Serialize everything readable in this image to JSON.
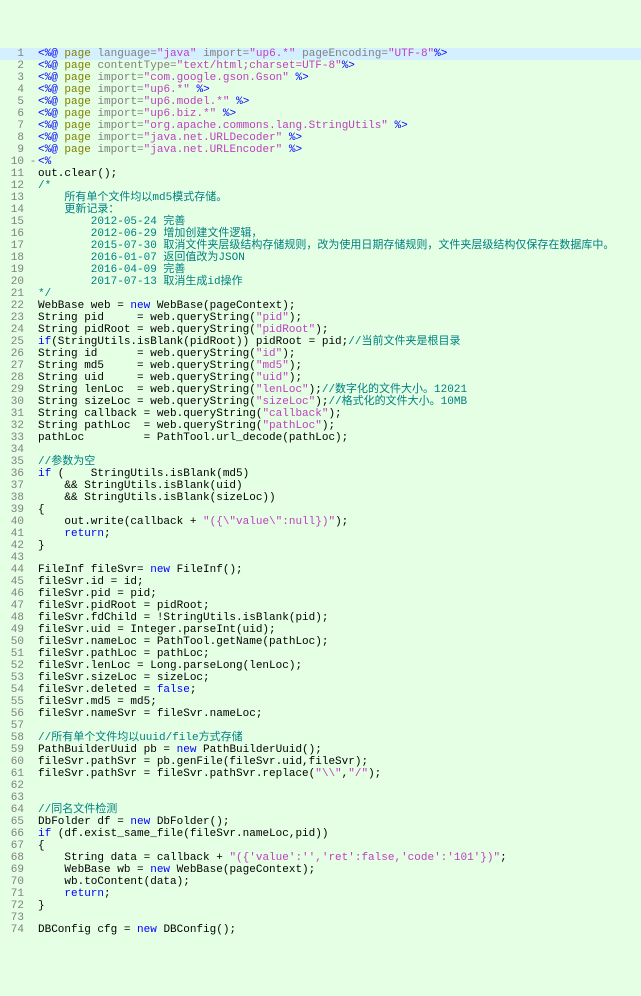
{
  "lines": [
    {
      "n": 1,
      "hl": true,
      "seg": [
        [
          "tag",
          "<%@"
        ],
        [
          "txt",
          " "
        ],
        [
          "dir",
          "page"
        ],
        [
          "txt",
          " "
        ],
        [
          "attr",
          "language="
        ],
        [
          "str",
          "\"java\""
        ],
        [
          "txt",
          " "
        ],
        [
          "attr",
          "import="
        ],
        [
          "str",
          "\"up6.*\""
        ],
        [
          "txt",
          " "
        ],
        [
          "attr",
          "pageEncoding="
        ],
        [
          "str",
          "\"UTF-8\""
        ],
        [
          "tag",
          "%>"
        ]
      ]
    },
    {
      "n": 2,
      "seg": [
        [
          "tag",
          "<%@"
        ],
        [
          "txt",
          " "
        ],
        [
          "dir",
          "page"
        ],
        [
          "txt",
          " "
        ],
        [
          "attr",
          "contentType="
        ],
        [
          "str",
          "\"text/html;charset=UTF-8\""
        ],
        [
          "tag",
          "%>"
        ]
      ]
    },
    {
      "n": 3,
      "seg": [
        [
          "tag",
          "<%@"
        ],
        [
          "txt",
          " "
        ],
        [
          "dir",
          "page"
        ],
        [
          "txt",
          " "
        ],
        [
          "attr",
          "import="
        ],
        [
          "str",
          "\"com.google.gson.Gson\""
        ],
        [
          "txt",
          " "
        ],
        [
          "tag",
          "%>"
        ]
      ]
    },
    {
      "n": 4,
      "seg": [
        [
          "tag",
          "<%@"
        ],
        [
          "txt",
          " "
        ],
        [
          "dir",
          "page"
        ],
        [
          "txt",
          " "
        ],
        [
          "attr",
          "import="
        ],
        [
          "str",
          "\"up6.*\""
        ],
        [
          "txt",
          " "
        ],
        [
          "tag",
          "%>"
        ]
      ]
    },
    {
      "n": 5,
      "seg": [
        [
          "tag",
          "<%@"
        ],
        [
          "txt",
          " "
        ],
        [
          "dir",
          "page"
        ],
        [
          "txt",
          " "
        ],
        [
          "attr",
          "import="
        ],
        [
          "str",
          "\"up6.model.*\""
        ],
        [
          "txt",
          " "
        ],
        [
          "tag",
          "%>"
        ]
      ]
    },
    {
      "n": 6,
      "seg": [
        [
          "tag",
          "<%@"
        ],
        [
          "txt",
          " "
        ],
        [
          "dir",
          "page"
        ],
        [
          "txt",
          " "
        ],
        [
          "attr",
          "import="
        ],
        [
          "str",
          "\"up6.biz.*\""
        ],
        [
          "txt",
          " "
        ],
        [
          "tag",
          "%>"
        ]
      ]
    },
    {
      "n": 7,
      "seg": [
        [
          "tag",
          "<%@"
        ],
        [
          "txt",
          " "
        ],
        [
          "dir",
          "page"
        ],
        [
          "txt",
          " "
        ],
        [
          "attr",
          "import="
        ],
        [
          "str",
          "\"org.apache.commons.lang.StringUtils\""
        ],
        [
          "txt",
          " "
        ],
        [
          "tag",
          "%>"
        ]
      ]
    },
    {
      "n": 8,
      "seg": [
        [
          "tag",
          "<%@"
        ],
        [
          "txt",
          " "
        ],
        [
          "dir",
          "page"
        ],
        [
          "txt",
          " "
        ],
        [
          "attr",
          "import="
        ],
        [
          "str",
          "\"java.net.URLDecoder\""
        ],
        [
          "txt",
          " "
        ],
        [
          "tag",
          "%>"
        ]
      ]
    },
    {
      "n": 9,
      "seg": [
        [
          "tag",
          "<%@"
        ],
        [
          "txt",
          " "
        ],
        [
          "dir",
          "page"
        ],
        [
          "txt",
          " "
        ],
        [
          "attr",
          "import="
        ],
        [
          "str",
          "\"java.net.URLEncoder\""
        ],
        [
          "txt",
          " "
        ],
        [
          "tag",
          "%>"
        ]
      ]
    },
    {
      "n": 10,
      "fold": "-",
      "seg": [
        [
          "tag",
          "<%"
        ]
      ]
    },
    {
      "n": 11,
      "seg": [
        [
          "txt",
          "out.clear();"
        ]
      ]
    },
    {
      "n": 12,
      "seg": [
        [
          "cm",
          "/*"
        ]
      ]
    },
    {
      "n": 13,
      "seg": [
        [
          "cm",
          "    所有单个文件均以md5模式存储。"
        ]
      ]
    },
    {
      "n": 14,
      "seg": [
        [
          "cm",
          "    更新记录："
        ]
      ]
    },
    {
      "n": 15,
      "seg": [
        [
          "cm",
          "        2012-05-24 完善"
        ]
      ]
    },
    {
      "n": 16,
      "seg": [
        [
          "cm",
          "        2012-06-29 增加创建文件逻辑，"
        ]
      ]
    },
    {
      "n": 17,
      "seg": [
        [
          "cm",
          "        2015-07-30 取消文件夹层级结构存储规则，改为使用日期存储规则，文件夹层级结构仅保存在数据库中。"
        ]
      ]
    },
    {
      "n": 18,
      "seg": [
        [
          "cm",
          "        2016-01-07 返回值改为JSON"
        ]
      ]
    },
    {
      "n": 19,
      "seg": [
        [
          "cm",
          "        2016-04-09 完善"
        ]
      ]
    },
    {
      "n": 20,
      "seg": [
        [
          "cm",
          "        2017-07-13 取消生成id操作"
        ]
      ]
    },
    {
      "n": 21,
      "seg": [
        [
          "cm",
          "*/"
        ]
      ]
    },
    {
      "n": 22,
      "seg": [
        [
          "txt",
          "WebBase web = "
        ],
        [
          "kw",
          "new"
        ],
        [
          "txt",
          " WebBase(pageContext);"
        ]
      ]
    },
    {
      "n": 23,
      "seg": [
        [
          "txt",
          "String pid     = web.queryString("
        ],
        [
          "str",
          "\"pid\""
        ],
        [
          "txt",
          ");"
        ]
      ]
    },
    {
      "n": 24,
      "seg": [
        [
          "txt",
          "String pidRoot = web.queryString("
        ],
        [
          "str",
          "\"pidRoot\""
        ],
        [
          "txt",
          ");"
        ]
      ]
    },
    {
      "n": 25,
      "seg": [
        [
          "kw",
          "if"
        ],
        [
          "txt",
          "(StringUtils.isBlank(pidRoot)) pidRoot = pid;"
        ],
        [
          "cm",
          "//当前文件夹是根目录"
        ]
      ]
    },
    {
      "n": 26,
      "seg": [
        [
          "txt",
          "String id      = web.queryString("
        ],
        [
          "str",
          "\"id\""
        ],
        [
          "txt",
          ");"
        ]
      ]
    },
    {
      "n": 27,
      "seg": [
        [
          "txt",
          "String md5     = web.queryString("
        ],
        [
          "str",
          "\"md5\""
        ],
        [
          "txt",
          ");"
        ]
      ]
    },
    {
      "n": 28,
      "seg": [
        [
          "txt",
          "String uid     = web.queryString("
        ],
        [
          "str",
          "\"uid\""
        ],
        [
          "txt",
          ");"
        ]
      ]
    },
    {
      "n": 29,
      "seg": [
        [
          "txt",
          "String lenLoc  = web.queryString("
        ],
        [
          "str",
          "\"lenLoc\""
        ],
        [
          "txt",
          ");"
        ],
        [
          "cm",
          "//数字化的文件大小。12021"
        ]
      ]
    },
    {
      "n": 30,
      "seg": [
        [
          "txt",
          "String sizeLoc = web.queryString("
        ],
        [
          "str",
          "\"sizeLoc\""
        ],
        [
          "txt",
          ");"
        ],
        [
          "cm",
          "//格式化的文件大小。10MB"
        ]
      ]
    },
    {
      "n": 31,
      "seg": [
        [
          "txt",
          "String callback = web.queryString("
        ],
        [
          "str",
          "\"callback\""
        ],
        [
          "txt",
          ");"
        ]
      ]
    },
    {
      "n": 32,
      "seg": [
        [
          "txt",
          "String pathLoc  = web.queryString("
        ],
        [
          "str",
          "\"pathLoc\""
        ],
        [
          "txt",
          ");"
        ]
      ]
    },
    {
      "n": 33,
      "seg": [
        [
          "txt",
          "pathLoc         = PathTool.url_decode(pathLoc);"
        ]
      ]
    },
    {
      "n": 34,
      "seg": [
        [
          "txt",
          ""
        ]
      ]
    },
    {
      "n": 35,
      "seg": [
        [
          "cm",
          "//参数为空"
        ]
      ]
    },
    {
      "n": 36,
      "seg": [
        [
          "kw",
          "if"
        ],
        [
          "txt",
          " (    StringUtils.isBlank(md5)"
        ]
      ]
    },
    {
      "n": 37,
      "seg": [
        [
          "txt",
          "    && StringUtils.isBlank(uid)"
        ]
      ]
    },
    {
      "n": 38,
      "seg": [
        [
          "txt",
          "    && StringUtils.isBlank(sizeLoc))"
        ]
      ]
    },
    {
      "n": 39,
      "seg": [
        [
          "txt",
          "{"
        ]
      ]
    },
    {
      "n": 40,
      "seg": [
        [
          "txt",
          "    out.write(callback + "
        ],
        [
          "str",
          "\"({\\\"value\\\":null})\""
        ],
        [
          "txt",
          ");"
        ]
      ]
    },
    {
      "n": 41,
      "seg": [
        [
          "txt",
          "    "
        ],
        [
          "kw",
          "return"
        ],
        [
          "txt",
          ";"
        ]
      ]
    },
    {
      "n": 42,
      "seg": [
        [
          "txt",
          "}"
        ]
      ]
    },
    {
      "n": 43,
      "seg": [
        [
          "txt",
          ""
        ]
      ]
    },
    {
      "n": 44,
      "seg": [
        [
          "txt",
          "FileInf fileSvr= "
        ],
        [
          "kw",
          "new"
        ],
        [
          "txt",
          " FileInf();"
        ]
      ]
    },
    {
      "n": 45,
      "seg": [
        [
          "txt",
          "fileSvr.id = id;"
        ]
      ]
    },
    {
      "n": 46,
      "seg": [
        [
          "txt",
          "fileSvr.pid = pid;"
        ]
      ]
    },
    {
      "n": 47,
      "seg": [
        [
          "txt",
          "fileSvr.pidRoot = pidRoot;"
        ]
      ]
    },
    {
      "n": 48,
      "seg": [
        [
          "txt",
          "fileSvr.fdChild = !StringUtils.isBlank(pid);"
        ]
      ]
    },
    {
      "n": 49,
      "seg": [
        [
          "txt",
          "fileSvr.uid = Integer.parseInt(uid);"
        ]
      ]
    },
    {
      "n": 50,
      "seg": [
        [
          "txt",
          "fileSvr.nameLoc = PathTool.getName(pathLoc);"
        ]
      ]
    },
    {
      "n": 51,
      "seg": [
        [
          "txt",
          "fileSvr.pathLoc = pathLoc;"
        ]
      ]
    },
    {
      "n": 52,
      "seg": [
        [
          "txt",
          "fileSvr.lenLoc = Long.parseLong(lenLoc);"
        ]
      ]
    },
    {
      "n": 53,
      "seg": [
        [
          "txt",
          "fileSvr.sizeLoc = sizeLoc;"
        ]
      ]
    },
    {
      "n": 54,
      "seg": [
        [
          "txt",
          "fileSvr.deleted = "
        ],
        [
          "kw",
          "false"
        ],
        [
          "txt",
          ";"
        ]
      ]
    },
    {
      "n": 55,
      "seg": [
        [
          "txt",
          "fileSvr.md5 = md5;"
        ]
      ]
    },
    {
      "n": 56,
      "seg": [
        [
          "txt",
          "fileSvr.nameSvr = fileSvr.nameLoc;"
        ]
      ]
    },
    {
      "n": 57,
      "seg": [
        [
          "txt",
          ""
        ]
      ]
    },
    {
      "n": 58,
      "seg": [
        [
          "cm",
          "//所有单个文件均以uuid/file方式存储"
        ]
      ]
    },
    {
      "n": 59,
      "seg": [
        [
          "txt",
          "PathBuilderUuid pb = "
        ],
        [
          "kw",
          "new"
        ],
        [
          "txt",
          " PathBuilderUuid();"
        ]
      ]
    },
    {
      "n": 60,
      "seg": [
        [
          "txt",
          "fileSvr.pathSvr = pb.genFile(fileSvr.uid,fileSvr);"
        ]
      ]
    },
    {
      "n": 61,
      "seg": [
        [
          "txt",
          "fileSvr.pathSvr = fileSvr.pathSvr.replace("
        ],
        [
          "str",
          "\"\\\\\""
        ],
        [
          "txt",
          ","
        ],
        [
          "str",
          "\"/\""
        ],
        [
          "txt",
          ");"
        ]
      ]
    },
    {
      "n": 62,
      "seg": [
        [
          "txt",
          ""
        ]
      ]
    },
    {
      "n": 63,
      "seg": [
        [
          "txt",
          ""
        ]
      ]
    },
    {
      "n": 64,
      "seg": [
        [
          "cm",
          "//同名文件检测"
        ]
      ]
    },
    {
      "n": 65,
      "seg": [
        [
          "txt",
          "DbFolder df = "
        ],
        [
          "kw",
          "new"
        ],
        [
          "txt",
          " DbFolder();"
        ]
      ]
    },
    {
      "n": 66,
      "seg": [
        [
          "kw",
          "if"
        ],
        [
          "txt",
          " (df.exist_same_file(fileSvr.nameLoc,pid))"
        ]
      ]
    },
    {
      "n": 67,
      "seg": [
        [
          "txt",
          "{"
        ]
      ]
    },
    {
      "n": 68,
      "seg": [
        [
          "txt",
          "    String data = callback + "
        ],
        [
          "str",
          "\"({'value':'','ret':false,'code':'101'})\""
        ],
        [
          "txt",
          ";"
        ]
      ]
    },
    {
      "n": 69,
      "seg": [
        [
          "txt",
          "    WebBase wb = "
        ],
        [
          "kw",
          "new"
        ],
        [
          "txt",
          " WebBase(pageContext);"
        ]
      ]
    },
    {
      "n": 70,
      "seg": [
        [
          "txt",
          "    wb.toContent(data);"
        ]
      ]
    },
    {
      "n": 71,
      "seg": [
        [
          "txt",
          "    "
        ],
        [
          "kw",
          "return"
        ],
        [
          "txt",
          ";"
        ]
      ]
    },
    {
      "n": 72,
      "seg": [
        [
          "txt",
          "}"
        ]
      ]
    },
    {
      "n": 73,
      "seg": [
        [
          "txt",
          ""
        ]
      ]
    },
    {
      "n": 74,
      "seg": [
        [
          "txt",
          "DBConfig cfg = "
        ],
        [
          "kw",
          "new"
        ],
        [
          "txt",
          " DBConfig();"
        ]
      ]
    }
  ]
}
